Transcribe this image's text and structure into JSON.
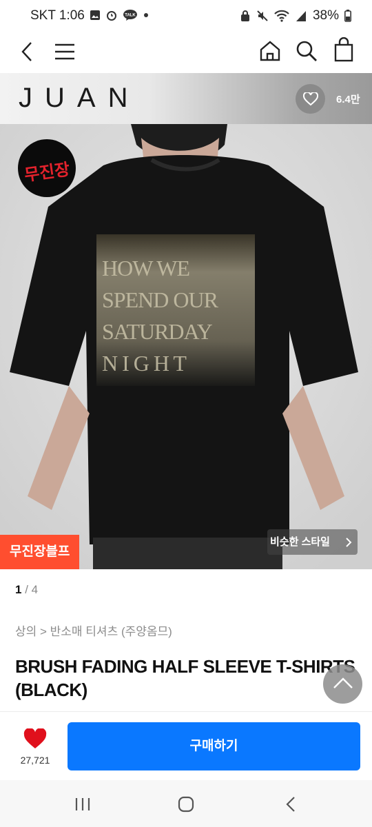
{
  "status_bar": {
    "time": "SKT 1:06",
    "battery": "38%"
  },
  "brand": {
    "name": "JUAN",
    "favorite_count": "6.4만"
  },
  "hero": {
    "sticker_text": "무진장",
    "badge": "무진장블프",
    "similar_style": "비슷한 스타일",
    "shirt_print": [
      "HOW    WE",
      "SPEND OUR",
      "SATURDAY",
      "N I G H T"
    ]
  },
  "pager": {
    "current": "1",
    "total": "/ 4"
  },
  "product": {
    "breadcrumb": "상의 > 반소매 티셔츠 (주양옴므)",
    "title": "BRUSH FADING HALF SLEEVE T-SHIRTS (BLACK)"
  },
  "bottom_bar": {
    "like_count": "27,721",
    "buy_label": "구매하기"
  },
  "colors": {
    "buy": "#0a78ff",
    "badge": "#ff4e2f",
    "heart": "#e0101c"
  }
}
